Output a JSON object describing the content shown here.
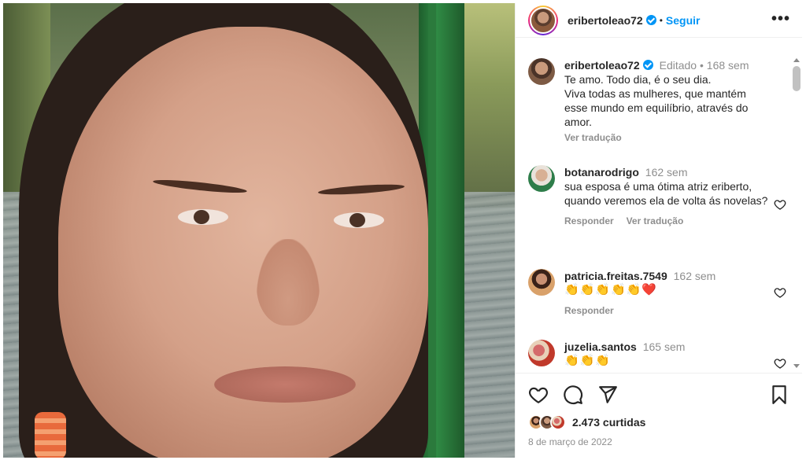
{
  "post": {
    "image_alt": "Close-up selfie of a woman smiling near a green pole with a river and trees behind"
  },
  "header": {
    "username": "eribertoleao72",
    "follow_label": "Seguir",
    "more_label": "•••"
  },
  "caption": {
    "username": "eribertoleao72",
    "edited_label": "Editado",
    "time": "168 sem",
    "lines": [
      "Te amo. Todo dia, é o seu dia.",
      "Viva todas as mulheres, que mantém esse mundo em equilíbrio, através do amor."
    ],
    "translate_label": "Ver tradução"
  },
  "comments": [
    {
      "username": "botanarodrigo",
      "time": "162 sem",
      "text": "sua esposa é uma ótima atriz eriberto, quando veremos ela de volta ás novelas?",
      "reply_label": "Responder",
      "translate_label": "Ver tradução"
    },
    {
      "username": "patricia.freitas.7549",
      "time": "162 sem",
      "text": "👏👏👏👏👏❤️",
      "reply_label": "Responder"
    },
    {
      "username": "juzelia.santos",
      "time": "165 sem",
      "text": "👏👏👏"
    }
  ],
  "actions": {
    "likes_count": "2.473 curtidas",
    "date": "8 de março de 2022"
  },
  "colors": {
    "accent": "#0095f6",
    "muted": "#8e8e8e",
    "text": "#262626"
  }
}
